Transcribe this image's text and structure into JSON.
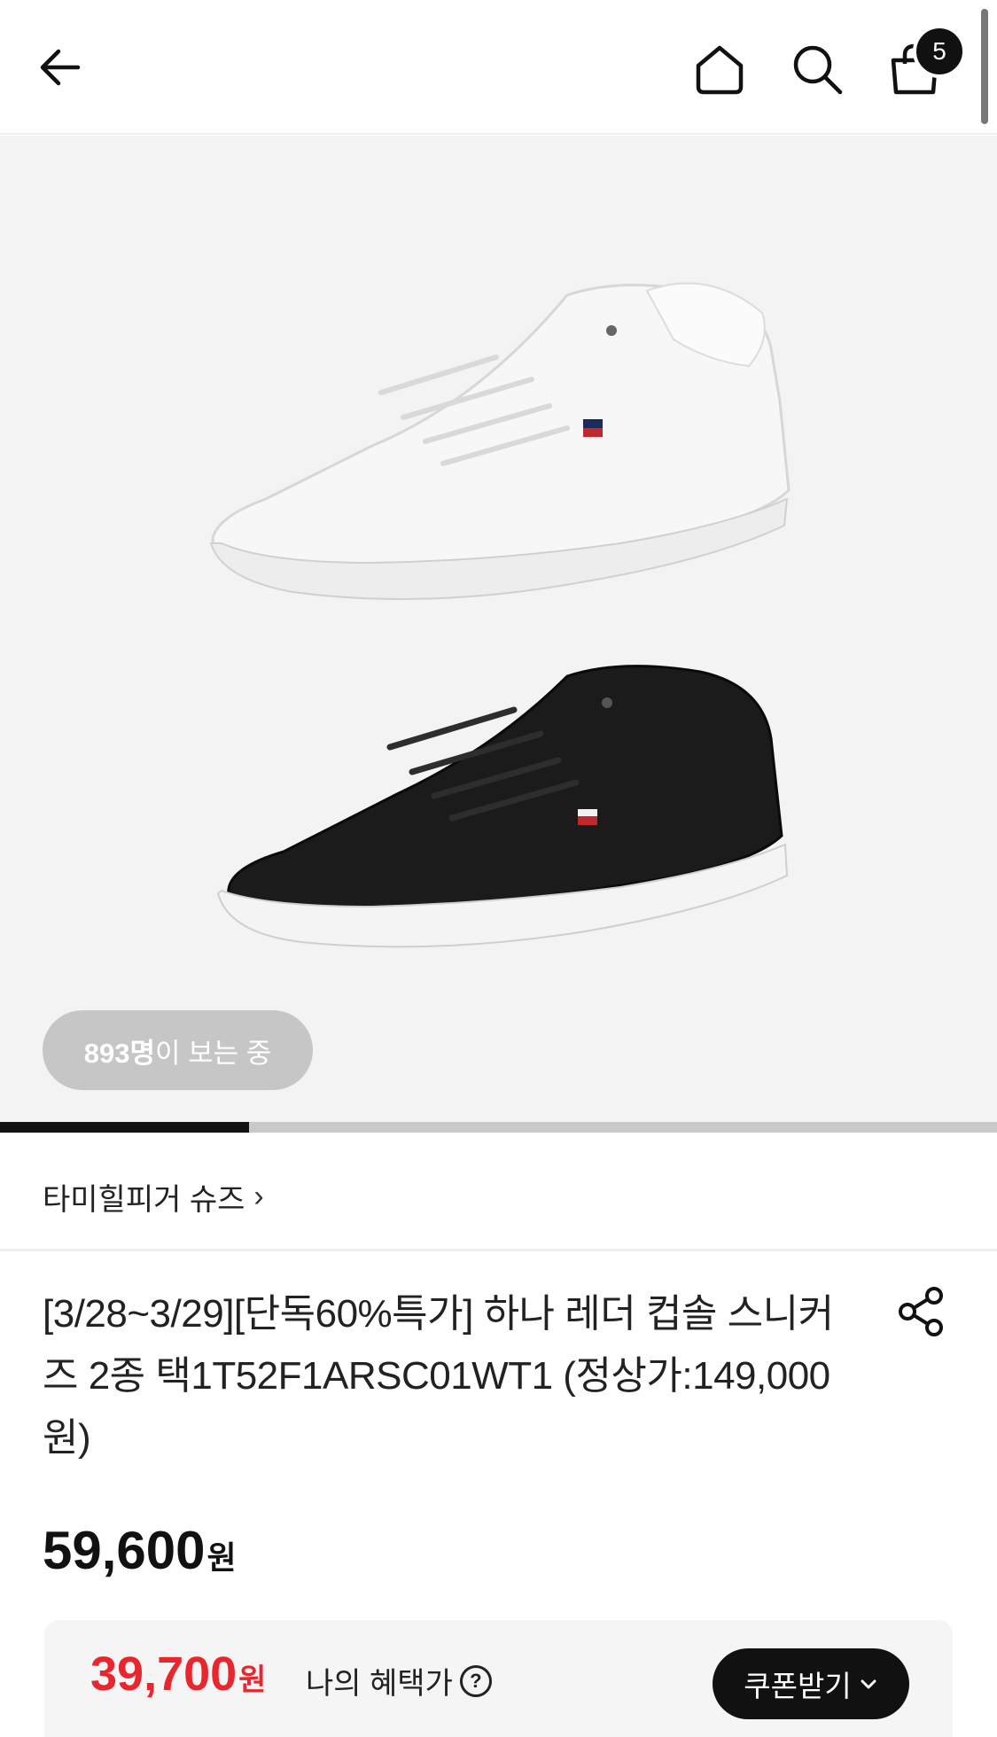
{
  "header": {
    "cart_count": "5"
  },
  "gallery": {
    "viewers_count": "893명",
    "viewers_suffix": "이 보는 중",
    "progress": 0.25,
    "colors": {
      "background": "#f3f3f3",
      "shoe_white": "#f7f7f7",
      "shoe_black": "#1b1b1b"
    }
  },
  "brand": {
    "name": "타미힐피거 슈즈",
    "chevron": "›"
  },
  "product": {
    "title": "[3/28~3/29][단독60%특가] 하나 레더 컵솔 스니커즈 2종 택1T52F1ARSC01WT1 (정상가:149,000원)",
    "price": "59,600",
    "price_unit": "원"
  },
  "benefit": {
    "price": "39,700",
    "price_unit": "원",
    "label": "나의 혜택가",
    "help_icon": "?",
    "coupon_label": "쿠폰받기",
    "accent": "#e8262e"
  }
}
